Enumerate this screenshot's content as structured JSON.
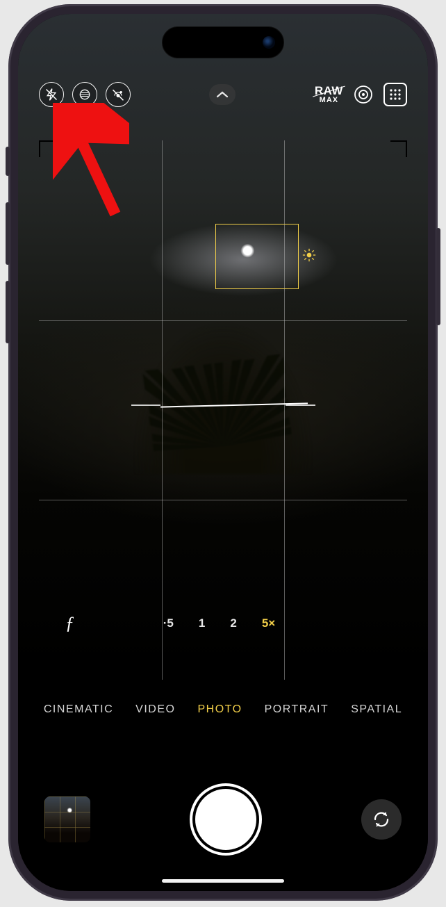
{
  "annotation": {
    "target": "night-mode-button"
  },
  "topControls": {
    "flash": {
      "name": "flash-off-icon",
      "state": "off"
    },
    "nightMode": {
      "name": "night-mode-icon",
      "state": "on"
    },
    "livePhoto": {
      "name": "live-photo-off-icon",
      "state": "off"
    },
    "chevron": {
      "name": "chevron-up-icon"
    },
    "raw": {
      "top": "RAW",
      "bottom": "MAX",
      "state": "off"
    },
    "photographicStyles": {
      "name": "target-icon"
    },
    "actionMode": {
      "name": "dots-grid-icon"
    }
  },
  "focus": {
    "exposureIcon": "sun-icon"
  },
  "zoom": {
    "apertureLabel": "ƒ",
    "options": [
      "·5",
      "1",
      "2",
      "5×"
    ],
    "active": "5×"
  },
  "modes": {
    "items": [
      "CINEMATIC",
      "VIDEO",
      "PHOTO",
      "PORTRAIT",
      "SPATIAL"
    ],
    "active": "PHOTO"
  },
  "bottom": {
    "thumbnailName": "last-photo-thumbnail",
    "shutterName": "shutter-button",
    "flipName": "camera-flip-button"
  },
  "colors": {
    "accent": "#f2cf49",
    "annotation": "#e11"
  }
}
